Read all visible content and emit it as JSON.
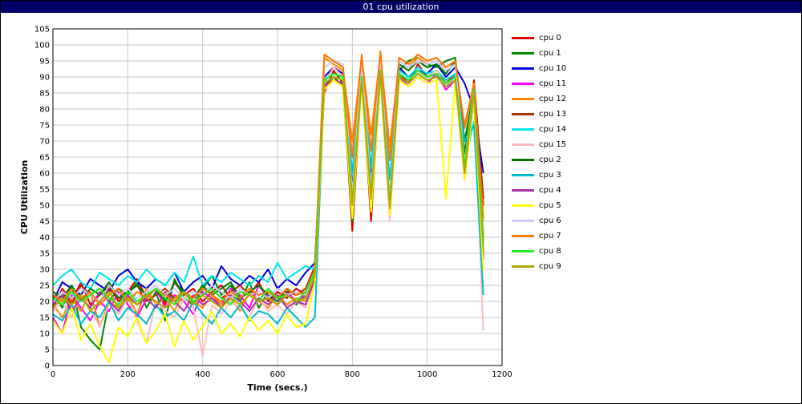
{
  "window": {
    "title": "01 cpu utilization"
  },
  "chart_data": {
    "type": "line",
    "title": "",
    "xlabel": "Time (secs.)",
    "ylabel": "CPU Utilization",
    "xlim": [
      0,
      1200
    ],
    "ylim": [
      0,
      105
    ],
    "xticks": [
      0,
      200,
      400,
      600,
      800,
      1000,
      1200
    ],
    "yticks": [
      0,
      5,
      10,
      15,
      20,
      25,
      30,
      35,
      40,
      45,
      50,
      55,
      60,
      65,
      70,
      75,
      80,
      85,
      90,
      95,
      100,
      105
    ],
    "grid": true,
    "legend_position": "right",
    "x": [
      0,
      25,
      50,
      75,
      100,
      125,
      150,
      175,
      200,
      225,
      250,
      275,
      300,
      325,
      350,
      375,
      400,
      425,
      450,
      475,
      500,
      525,
      550,
      575,
      600,
      625,
      650,
      675,
      700,
      725,
      750,
      775,
      800,
      825,
      850,
      875,
      900,
      925,
      950,
      975,
      1000,
      1025,
      1050,
      1075,
      1100,
      1125,
      1150
    ],
    "series": [
      {
        "name": "cpu 0",
        "color": "#dd0000",
        "values": [
          18,
          24,
          20,
          26,
          19,
          22,
          25,
          20,
          23,
          27,
          21,
          24,
          19,
          26,
          22,
          24,
          20,
          23,
          25,
          21,
          24,
          22,
          26,
          20,
          23,
          21,
          24,
          22,
          30,
          85,
          92,
          88,
          42,
          90,
          45,
          93,
          47,
          91,
          88,
          94,
          90,
          92,
          88,
          91,
          60,
          89,
          52
        ]
      },
      {
        "name": "cpu 1",
        "color": "#008800",
        "values": [
          22,
          18,
          25,
          12,
          8,
          5,
          20,
          24,
          22,
          26,
          18,
          23,
          14,
          27,
          21,
          19,
          24,
          28,
          22,
          25,
          20,
          26,
          18,
          23,
          21,
          24,
          19,
          22,
          28,
          88,
          90,
          87,
          45,
          92,
          48,
          90,
          50,
          92,
          95,
          96,
          94,
          93,
          95,
          96,
          70,
          86,
          35
        ]
      },
      {
        "name": "cpu 10",
        "color": "#0000dd",
        "values": [
          20,
          26,
          24,
          22,
          27,
          25,
          23,
          28,
          30,
          26,
          24,
          27,
          25,
          29,
          23,
          26,
          28,
          24,
          31,
          27,
          25,
          28,
          26,
          30,
          24,
          27,
          25,
          29,
          32,
          90,
          93,
          91,
          55,
          92,
          58,
          94,
          50,
          93,
          90,
          92,
          91,
          94,
          90,
          93,
          88,
          80,
          60
        ]
      },
      {
        "name": "cpu 11",
        "color": "#ff00ff",
        "values": [
          15,
          10,
          22,
          18,
          14,
          20,
          17,
          23,
          19,
          15,
          21,
          24,
          18,
          22,
          20,
          16,
          23,
          21,
          19,
          24,
          22,
          18,
          25,
          21,
          19,
          23,
          20,
          22,
          27,
          86,
          89,
          88,
          48,
          89,
          50,
          91,
          46,
          90,
          87,
          90,
          88,
          91,
          86,
          89,
          58,
          85,
          33
        ]
      },
      {
        "name": "cpu 12",
        "color": "#ff8800",
        "values": [
          19,
          15,
          21,
          17,
          23,
          12,
          20,
          18,
          22,
          16,
          24,
          19,
          21,
          17,
          23,
          20,
          18,
          22,
          19,
          21,
          17,
          23,
          20,
          18,
          22,
          19,
          21,
          20,
          28,
          96,
          94,
          92,
          70,
          96,
          72,
          97,
          68,
          95,
          93,
          96,
          94,
          95,
          92,
          94,
          75,
          88,
          45
        ]
      },
      {
        "name": "cpu 13",
        "color": "#aa3300",
        "values": [
          21,
          23,
          19,
          25,
          22,
          20,
          24,
          21,
          23,
          25,
          20,
          22,
          24,
          21,
          23,
          20,
          22,
          24,
          21,
          23,
          25,
          22,
          20,
          24,
          21,
          23,
          22,
          24,
          31,
          87,
          90,
          89,
          50,
          90,
          52,
          92,
          49,
          91,
          89,
          92,
          90,
          91,
          88,
          90,
          62,
          86,
          50
        ]
      },
      {
        "name": "cpu 14",
        "color": "#00e5e5",
        "values": [
          25,
          28,
          30,
          26,
          24,
          29,
          27,
          25,
          28,
          26,
          30,
          27,
          25,
          29,
          26,
          34,
          25,
          28,
          26,
          29,
          27,
          25,
          28,
          26,
          32,
          27,
          29,
          31,
          30,
          89,
          91,
          90,
          54,
          91,
          56,
          93,
          52,
          92,
          90,
          93,
          91,
          92,
          89,
          91,
          64,
          76,
          38
        ]
      },
      {
        "name": "cpu 15",
        "color": "#ffbbbb",
        "values": [
          17,
          20,
          15,
          22,
          18,
          12,
          19,
          16,
          21,
          14,
          7,
          20,
          17,
          15,
          21,
          18,
          3,
          19,
          16,
          20,
          18,
          15,
          21,
          17,
          19,
          16,
          20,
          18,
          26,
          88,
          93,
          90,
          47,
          92,
          49,
          94,
          45,
          91,
          89,
          92,
          90,
          92,
          87,
          90,
          59,
          84,
          11
        ]
      },
      {
        "name": "cpu 2",
        "color": "#007700",
        "values": [
          23,
          21,
          25,
          20,
          24,
          22,
          26,
          21,
          23,
          25,
          22,
          24,
          20,
          26,
          23,
          21,
          25,
          22,
          24,
          26,
          21,
          23,
          25,
          22,
          20,
          24,
          22,
          23,
          29,
          89,
          91,
          90,
          52,
          91,
          54,
          93,
          51,
          94,
          92,
          95,
          93,
          94,
          91,
          95,
          66,
          87,
          40
        ]
      },
      {
        "name": "cpu 3",
        "color": "#00bbcc",
        "values": [
          16,
          14,
          19,
          13,
          17,
          15,
          20,
          14,
          18,
          16,
          13,
          19,
          15,
          17,
          14,
          20,
          16,
          13,
          18,
          15,
          19,
          14,
          17,
          16,
          13,
          18,
          15,
          12,
          15,
          88,
          90,
          89,
          60,
          90,
          62,
          92,
          58,
          91,
          89,
          92,
          90,
          91,
          88,
          90,
          70,
          75,
          22
        ]
      },
      {
        "name": "cpu 4",
        "color": "#aa33aa",
        "values": [
          19,
          22,
          17,
          21,
          18,
          23,
          20,
          17,
          22,
          19,
          21,
          18,
          23,
          20,
          17,
          22,
          19,
          21,
          18,
          22,
          20,
          17,
          21,
          19,
          22,
          18,
          20,
          19,
          27,
          87,
          89,
          88,
          49,
          89,
          51,
          91,
          48,
          90,
          88,
          91,
          89,
          90,
          87,
          89,
          61,
          85,
          34
        ]
      },
      {
        "name": "cpu 5",
        "color": "#ffff00",
        "values": [
          14,
          10,
          18,
          8,
          13,
          6,
          1,
          12,
          9,
          15,
          7,
          11,
          16,
          6,
          14,
          8,
          12,
          17,
          10,
          13,
          9,
          15,
          11,
          14,
          10,
          16,
          12,
          13,
          26,
          86,
          89,
          87,
          46,
          88,
          48,
          90,
          47,
          89,
          87,
          90,
          88,
          89,
          52,
          88,
          58,
          83,
          30
        ]
      },
      {
        "name": "cpu 6",
        "color": "#ccccff",
        "values": [
          20,
          23,
          21,
          24,
          22,
          20,
          25,
          22,
          24,
          21,
          23,
          25,
          22,
          24,
          21,
          23,
          22,
          25,
          23,
          21,
          24,
          22,
          23,
          21,
          24,
          22,
          23,
          22,
          29,
          93,
          95,
          94,
          53,
          94,
          55,
          96,
          51,
          95,
          93,
          95,
          94,
          95,
          92,
          94,
          63,
          87,
          42
        ]
      },
      {
        "name": "cpu 7",
        "color": "#ff7700",
        "values": [
          22,
          20,
          24,
          21,
          23,
          19,
          22,
          24,
          20,
          23,
          21,
          24,
          22,
          20,
          23,
          21,
          24,
          22,
          20,
          23,
          21,
          24,
          22,
          23,
          21,
          24,
          22,
          23,
          30,
          97,
          95,
          93,
          65,
          97,
          67,
          98,
          64,
          96,
          94,
          97,
          95,
          96,
          93,
          95,
          74,
          88,
          46
        ]
      },
      {
        "name": "cpu 8",
        "color": "#22ee22",
        "values": [
          21,
          19,
          23,
          20,
          22,
          24,
          21,
          19,
          23,
          20,
          22,
          24,
          21,
          19,
          23,
          20,
          22,
          24,
          21,
          19,
          23,
          22,
          20,
          24,
          21,
          22,
          20,
          23,
          29,
          89,
          91,
          90,
          51,
          90,
          53,
          92,
          50,
          91,
          89,
          92,
          90,
          91,
          88,
          90,
          62,
          86,
          39
        ]
      },
      {
        "name": "cpu 9",
        "color": "#aaaa00",
        "values": [
          18,
          21,
          19,
          22,
          17,
          20,
          23,
          18,
          21,
          19,
          22,
          20,
          18,
          21,
          23,
          19,
          22,
          20,
          18,
          21,
          19,
          22,
          20,
          21,
          19,
          22,
          20,
          21,
          28,
          88,
          90,
          89,
          50,
          89,
          52,
          91,
          49,
          90,
          88,
          91,
          89,
          90,
          87,
          89,
          60,
          85,
          36
        ]
      }
    ]
  }
}
